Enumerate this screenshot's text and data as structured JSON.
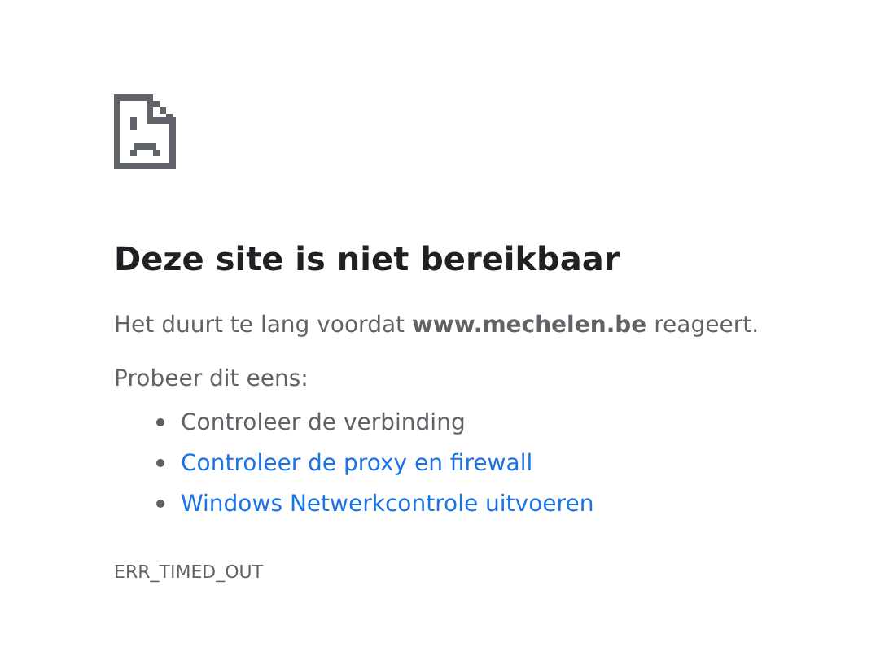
{
  "heading": "Deze site is niet bereikbaar",
  "message": "Het duurt te lang voordat **www.mechelen.be** reageert.",
  "suggestions_intro": "Probeer dit eens:",
  "suggestions": [
    {
      "kind": "text",
      "label": "Controleer de verbinding"
    },
    {
      "kind": "link",
      "label": "Controleer de proxy en firewall"
    },
    {
      "kind": "link",
      "label": "Windows Netwerkcontrole uitvoeren"
    }
  ],
  "error_code": "ERR_TIMED_OUT"
}
